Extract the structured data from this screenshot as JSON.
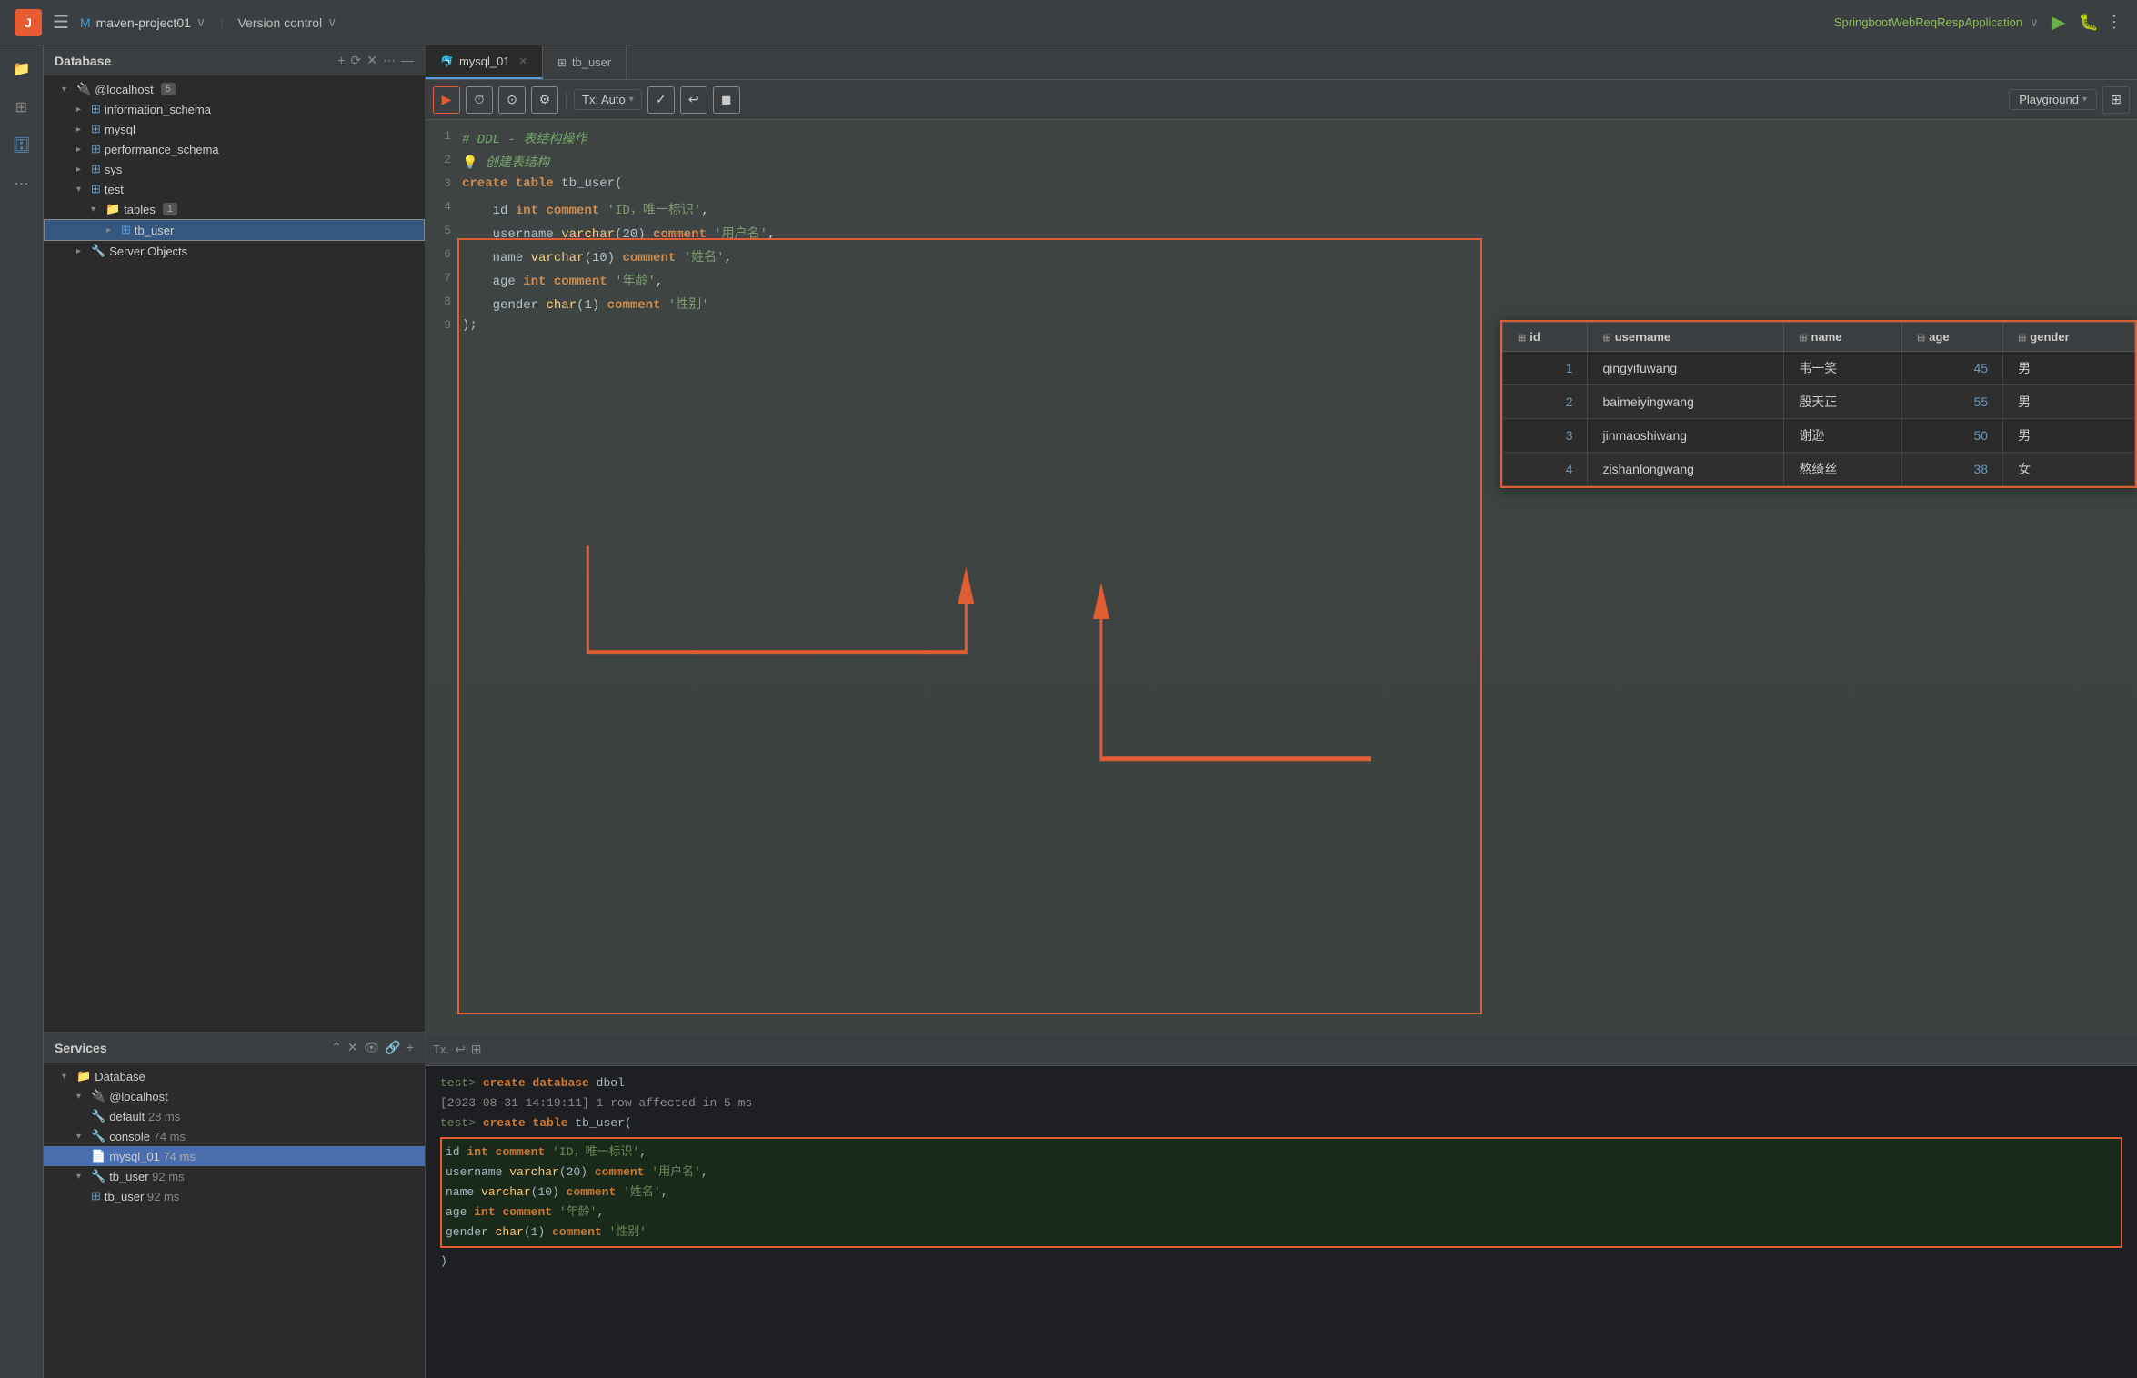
{
  "app": {
    "project": "maven-project01",
    "version_control": "Version control",
    "run_app": "SpringbootWebReqRespApplication"
  },
  "db_panel": {
    "title": "Database",
    "localhost": "@localhost",
    "localhost_count": "5",
    "databases": [
      {
        "name": "information_schema",
        "icon": "db"
      },
      {
        "name": "mysql",
        "icon": "db"
      },
      {
        "name": "performance_schema",
        "icon": "db"
      },
      {
        "name": "sys",
        "icon": "db"
      },
      {
        "name": "test",
        "icon": "db",
        "expanded": true
      }
    ],
    "tables_label": "tables",
    "tables_count": "1",
    "tb_user": "tb_user",
    "server_objects": "Server Objects"
  },
  "tabs": [
    {
      "label": "mysql_01",
      "icon": "🐬",
      "active": true
    },
    {
      "label": "tb_user",
      "icon": "⊞",
      "active": false
    }
  ],
  "toolbar": {
    "tx_label": "Tx: Auto",
    "playground_label": "Playground"
  },
  "code": {
    "lines": [
      "# DDL - 表结构操作",
      "💡 创建表结构",
      "create table tb_user(",
      "    id int comment 'ID，唯一标识',",
      "    username varchar(20) comment '用户名',",
      "    name varchar(10) comment '姓名',",
      "    age int comment '年龄',",
      "    gender char(1) comment '性别'",
      ");"
    ]
  },
  "result_table": {
    "columns": [
      "id",
      "username",
      "name",
      "age",
      "gender"
    ],
    "rows": [
      [
        "1",
        "qingyifuwang",
        "韦一笑",
        "45",
        "男"
      ],
      [
        "2",
        "baimeiyingwang",
        "殷天正",
        "55",
        "男"
      ],
      [
        "3",
        "jinmaoshiwang",
        "谢逊",
        "50",
        "男"
      ],
      [
        "4",
        "zishanlongwang",
        "熬绮丝",
        "38",
        "女"
      ]
    ]
  },
  "console": {
    "tx_label": "Tx.",
    "log_lines": [
      "test> create database dbol",
      "[2023-08-31 14:19:11] 1 row affected in 5 ms",
      "test> create table tb_user("
    ],
    "code_lines": [
      "        id int comment 'ID，唯一标识',",
      "        username varchar(20) comment '用户名',",
      "        name varchar(10) comment '姓名',",
      "        age int comment '年龄',",
      "        gender char(1) comment '性别'"
    ],
    "closing": ")"
  },
  "services": {
    "title": "Services",
    "items": [
      {
        "label": "Database",
        "indent": 0,
        "expanded": true
      },
      {
        "label": "@localhost",
        "indent": 1,
        "expanded": true
      },
      {
        "label": "default  28 ms",
        "indent": 2
      },
      {
        "label": "console  74 ms",
        "indent": 1,
        "expanded": true
      },
      {
        "label": "mysql_01  74 ms",
        "indent": 2,
        "selected": true
      },
      {
        "label": "tb_user  92 ms",
        "indent": 1,
        "expanded": true
      },
      {
        "label": "tb_user  92 ms",
        "indent": 2
      }
    ]
  }
}
